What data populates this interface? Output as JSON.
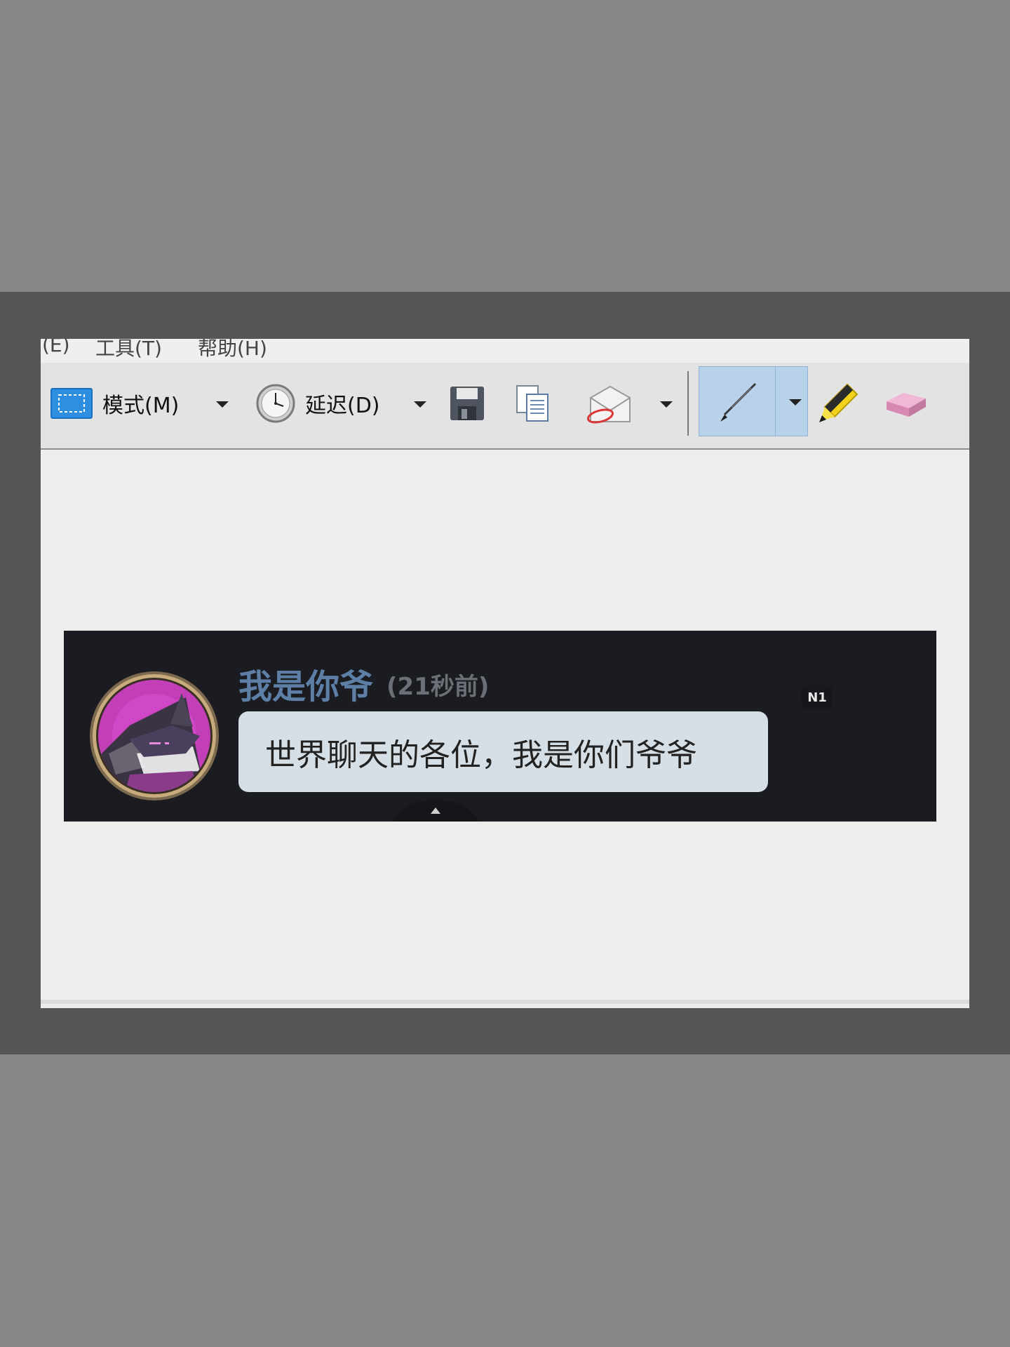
{
  "menubar": {
    "items": [
      {
        "label": "(E)"
      },
      {
        "label": "工具(T)"
      },
      {
        "label": "帮助(H)"
      }
    ]
  },
  "toolbar": {
    "mode_label": "模式(M)",
    "delay_label": "延迟(D)",
    "icons": [
      "mode-rectangle-icon",
      "clock-icon",
      "save-icon",
      "copy-icon",
      "email-icon",
      "pen-icon",
      "highlighter-icon",
      "eraser-icon"
    ]
  },
  "chat": {
    "username": "我是你爷",
    "timestamp": "(21秒前)",
    "message": "世界聊天的各位，我是你们爷爷",
    "badge": "N1"
  },
  "colors": {
    "background_outer": "#878787",
    "background_band": "#555555",
    "window_bg": "#ededed",
    "toolbar_bg": "#e3e3e3",
    "pen_active": "#b8d2ea",
    "chat_bg": "#1b1c21",
    "username": "#5d7fa6",
    "bubble": "#d6dfe5",
    "avatar_ring": "#b89a6e",
    "avatar_fill": "#b93ab5"
  }
}
